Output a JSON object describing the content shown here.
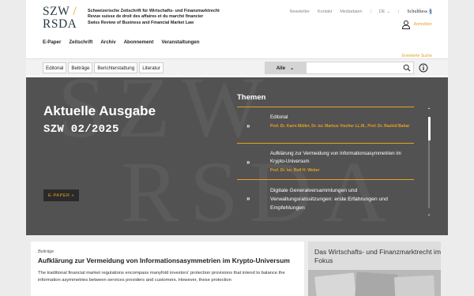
{
  "logo": {
    "line1": "SZW",
    "slash": "/",
    "line2": "RSDA"
  },
  "tagline": [
    "Schweizerische Zeitschrift für Wirtschafts- und Finanzmarktrecht",
    "Revue suisse de droit des affaires et du marché financier",
    "Swiss Review of Business and Financial Market Law"
  ],
  "utility": {
    "newsletter": "Newsletter",
    "kontakt": "Kontakt",
    "mediadaten": "Mediadaten",
    "lang": "DE",
    "publisher": "Schulthess",
    "publisher_mark": "§"
  },
  "login": {
    "label": "Anmelden"
  },
  "mainnav": [
    "E-Paper",
    "Zeitschrift",
    "Archiv",
    "Abonnement",
    "Veranstaltungen"
  ],
  "extended_search": "Erweiterte Suche",
  "tabs": [
    "Editorial",
    "Beiträge",
    "Berichterstattung",
    "Literatur"
  ],
  "search": {
    "scope": "Alle",
    "placeholder": ""
  },
  "hero": {
    "title": "Aktuelle Ausgabe",
    "issue": "SZW 02/2025",
    "epaper_button": "E-PAPER »",
    "themes_title": "Themen",
    "themes": [
      {
        "title": "Editorial",
        "authors": "Prof. Dr. Karin Müller, Dr. iur. Markus Vischer LL.M., Prof. Dr. Rashid Bahar"
      },
      {
        "title": "Aufklärung zur Vermeidung von Informationsasymmetrien im Krypto-Universum",
        "authors": "Prof. Dr. iur. Rolf H. Weber"
      },
      {
        "title": "Digitale Generalversammlungen und Verwaltungsratssitzungen: erste  Erfahrungen und Empfehlungen",
        "authors": ""
      }
    ]
  },
  "article": {
    "kicker": "Beiträge",
    "title": "Aufklärung zur Vermeidung von Informationsasymmetrien im Krypto-Universum",
    "body": "The traditional financial market regulations encompass manyfold investors' protection provisions that intend to balance the information asymmetries between services providers and customers. However, these protection"
  },
  "promo": {
    "title": "Das Wirtschafts- und Finanzmarktrecht im Fokus"
  },
  "colors": {
    "accent": "#e8a020",
    "hero_bg": "#525252",
    "brand": "#2b3a42"
  }
}
